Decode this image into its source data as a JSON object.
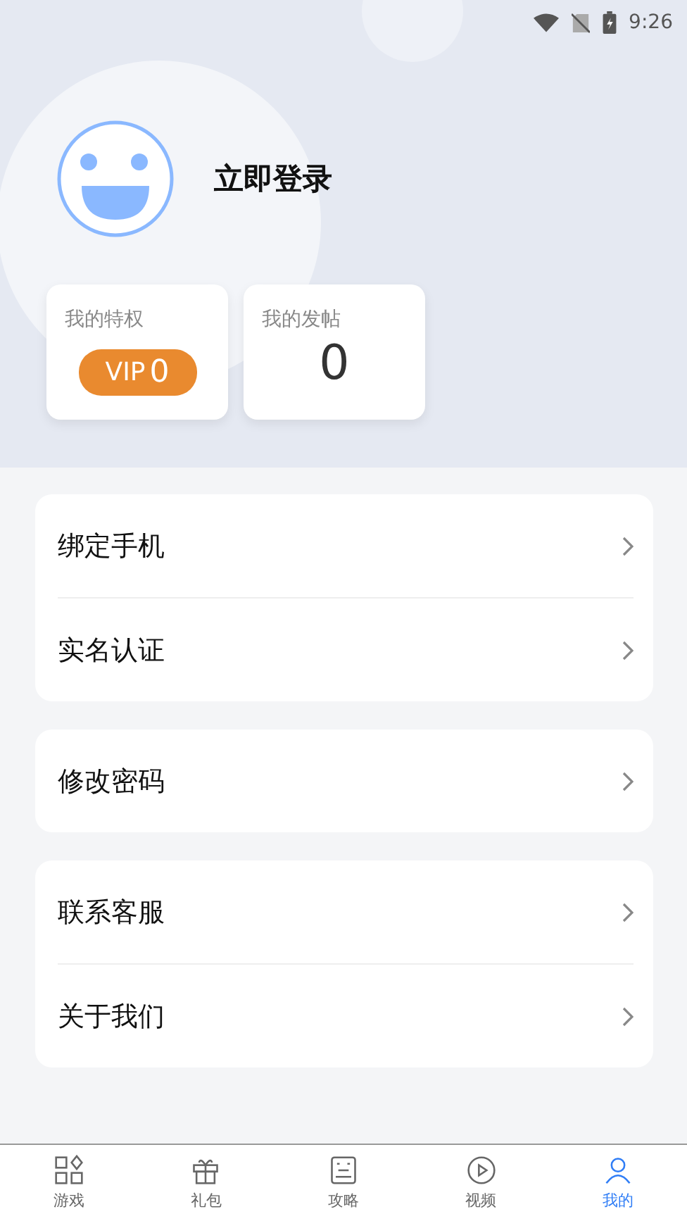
{
  "status_bar": {
    "time": "9:26"
  },
  "profile": {
    "login_label": "立即登录"
  },
  "stats": [
    {
      "kind": "vip",
      "title": "我的特权",
      "badge_label": "VIP",
      "badge_value": "0"
    },
    {
      "kind": "count",
      "title": "我的发帖",
      "value": "0"
    }
  ],
  "menu_groups": [
    {
      "items": [
        {
          "label": "绑定手机"
        },
        {
          "label": "实名认证"
        }
      ]
    },
    {
      "items": [
        {
          "label": "修改密码"
        }
      ]
    },
    {
      "items": [
        {
          "label": "联系客服"
        },
        {
          "label": "关于我们"
        }
      ]
    }
  ],
  "tab_bar": [
    {
      "kind": "games",
      "label": "游戏",
      "selected": false
    },
    {
      "kind": "gift",
      "label": "礼包",
      "selected": false
    },
    {
      "kind": "guide",
      "label": "攻略",
      "selected": false
    },
    {
      "kind": "video",
      "label": "视频",
      "selected": false
    },
    {
      "kind": "me",
      "label": "我的",
      "selected": true
    }
  ]
}
